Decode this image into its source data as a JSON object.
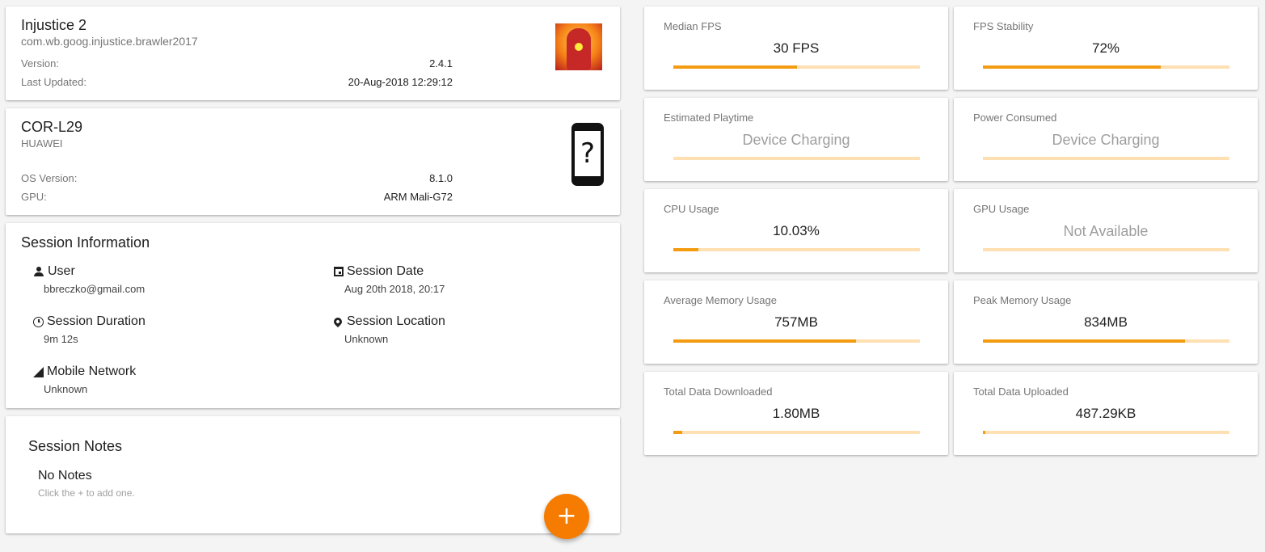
{
  "app": {
    "name": "Injustice 2",
    "package": "com.wb.goog.injustice.brawler2017",
    "version_label": "Version:",
    "version": "2.4.1",
    "updated_label": "Last Updated:",
    "updated": "20-Aug-2018 12:29:12"
  },
  "device": {
    "model": "COR-L29",
    "maker": "HUAWEI",
    "os_label": "OS Version:",
    "os": "8.1.0",
    "gpu_label": "GPU:",
    "gpu": "ARM Mali-G72",
    "unknown_glyph": "?"
  },
  "session": {
    "title": "Session Information",
    "user_label": "User",
    "user": "bbreczko@gmail.com",
    "date_label": "Session Date",
    "date": "Aug 20th 2018, 20:17",
    "duration_label": "Session Duration",
    "duration": "9m 12s",
    "location_label": "Session Location",
    "location": "Unknown",
    "network_label": "Mobile Network",
    "network": "Unknown"
  },
  "notes": {
    "title": "Session Notes",
    "empty": "No Notes",
    "hint": "Click the + to add one.",
    "add": "+"
  },
  "metrics": [
    {
      "id": "median-fps",
      "label": "Median FPS",
      "value": "30 FPS",
      "fill": 0.5,
      "available": true
    },
    {
      "id": "fps-stability",
      "label": "FPS Stability",
      "value": "72%",
      "fill": 0.72,
      "available": true
    },
    {
      "id": "estimated-playtime",
      "label": "Estimated Playtime",
      "value": "Device Charging",
      "fill": 0,
      "available": false
    },
    {
      "id": "power-consumed",
      "label": "Power Consumed",
      "value": "Device Charging",
      "fill": 0,
      "available": false
    },
    {
      "id": "cpu-usage",
      "label": "CPU Usage",
      "value": "10.03%",
      "fill": 0.1003,
      "available": true
    },
    {
      "id": "gpu-usage",
      "label": "GPU Usage",
      "value": "Not Available",
      "fill": 0,
      "available": false
    },
    {
      "id": "average-memory-usage",
      "label": "Average Memory Usage",
      "value": "757MB",
      "fill": 0.74,
      "available": true
    },
    {
      "id": "peak-memory-usage",
      "label": "Peak Memory Usage",
      "value": "834MB",
      "fill": 0.82,
      "available": true
    },
    {
      "id": "total-data-downloaded",
      "label": "Total Data Downloaded",
      "value": "1.80MB",
      "fill": 0.035,
      "available": true
    },
    {
      "id": "total-data-uploaded",
      "label": "Total Data Uploaded",
      "value": "487.29KB",
      "fill": 0.01,
      "available": true
    }
  ],
  "colors": {
    "accent": "#f57c00",
    "bar_fill": "#f39c12",
    "bar_track": "#ffe0b2"
  }
}
